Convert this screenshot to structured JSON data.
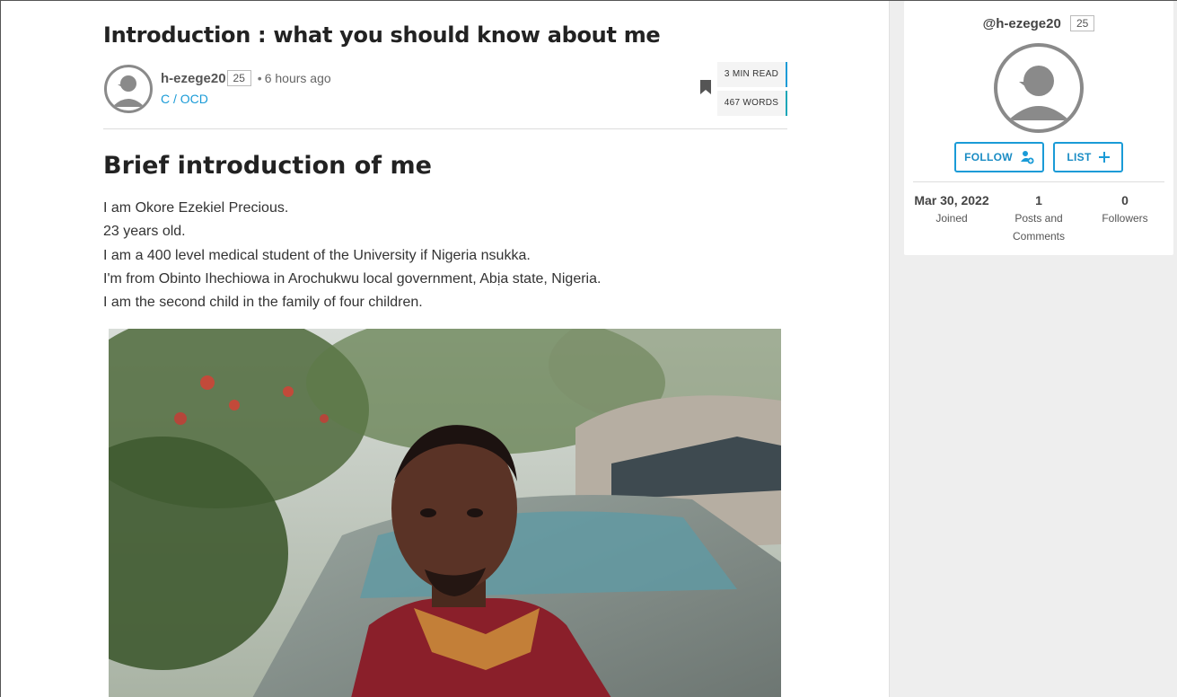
{
  "post": {
    "title": "Introduction : what you should know about me",
    "author": "h-ezege20",
    "reputation": "25",
    "separator": "•",
    "time_ago": "6 hours ago",
    "community": "C / OCD",
    "read_time": "3 MIN READ",
    "word_count": "467 WORDS"
  },
  "content": {
    "heading": "Brief introduction of me",
    "paragraphs": [
      "I am Okore Ezekiel Precious.",
      "23 years old.",
      "I am a 400 level medical student of the University if Nigeria nsukka.",
      "I'm from Obinto Ihechiowa in Arochukwu local government, Abịa state, Nigeria.",
      "I am the second child in the family of four children."
    ]
  },
  "sidebar": {
    "handle": "@h-ezege20",
    "reputation": "25",
    "follow_label": "FOLLOW",
    "list_label": "LIST",
    "stats": [
      {
        "value": "Mar 30, 2022",
        "label": "Joined"
      },
      {
        "value": "1",
        "label": "Posts and Comments"
      },
      {
        "value": "0",
        "label": "Followers"
      }
    ]
  },
  "icons": {
    "bookmark": "bookmark-icon",
    "follow": "add-user-icon",
    "list": "plus-icon",
    "avatar": "default-avatar-icon"
  },
  "colors": {
    "accent": "#1a9bd7",
    "sidebar_bg": "#eeeeee",
    "avatar_gray": "#8a8a8a"
  }
}
